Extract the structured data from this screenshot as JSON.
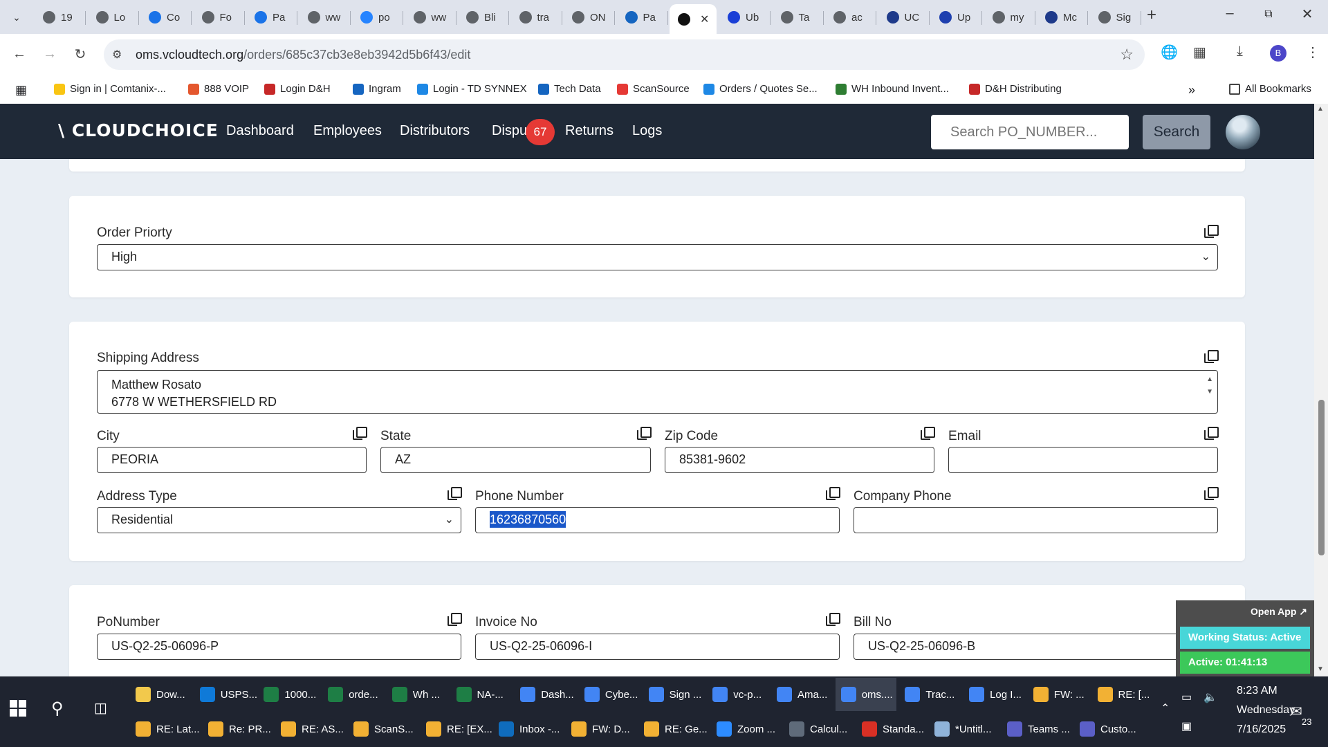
{
  "browser": {
    "tabs": [
      {
        "label": "19",
        "icon": "globe-icon",
        "color": "#5f6368"
      },
      {
        "label": "Lo",
        "icon": "globe-icon",
        "color": "#5f6368"
      },
      {
        "label": "Co",
        "icon": "logi-icon",
        "color": "#1a73e8"
      },
      {
        "label": "Fo",
        "icon": "globe-icon",
        "color": "#5f6368"
      },
      {
        "label": "Pa",
        "icon": "chevron-icon",
        "color": "#1a73e8"
      },
      {
        "label": "ww",
        "icon": "globe-icon",
        "color": "#5f6368"
      },
      {
        "label": "po",
        "icon": "jira-icon",
        "color": "#2684ff"
      },
      {
        "label": "ww",
        "icon": "globe-icon",
        "color": "#5f6368"
      },
      {
        "label": "Bli",
        "icon": "globe-icon",
        "color": "#5f6368"
      },
      {
        "label": "tra",
        "icon": "globe-icon",
        "color": "#5f6368"
      },
      {
        "label": "ON",
        "icon": "globe-icon",
        "color": "#5f6368"
      },
      {
        "label": "Pa",
        "icon": "cloud-icon",
        "color": "#1565c0"
      },
      {
        "label": "",
        "icon": "active-site-icon",
        "color": "#111111",
        "active": true
      },
      {
        "label": "Ub",
        "icon": "u-icon",
        "color": "#1a3fd6"
      },
      {
        "label": "Ta",
        "icon": "globe-icon",
        "color": "#5f6368"
      },
      {
        "label": "ac",
        "icon": "globe-icon",
        "color": "#5f6368"
      },
      {
        "label": "UC",
        "icon": "uc-icon",
        "color": "#1e3a8a"
      },
      {
        "label": "Up",
        "icon": "check-icon",
        "color": "#1e40af"
      },
      {
        "label": "my",
        "icon": "globe-icon",
        "color": "#5f6368"
      },
      {
        "label": "Mc",
        "icon": "etn-icon",
        "color": "#1e3a8a"
      },
      {
        "label": "Sig",
        "icon": "globe-icon",
        "color": "#5f6368"
      }
    ],
    "url_domain": "oms.vcloudtech.org",
    "url_path": "/orders/685c37cb3e8eb3942d5b6f43/edit",
    "profile_initial": "B",
    "bookmarks": [
      {
        "label": "Sign in | Comtanix-...",
        "color": "#f9c513"
      },
      {
        "label": "888 VOIP",
        "color": "#e4572e"
      },
      {
        "label": "Login D&H",
        "color": "#c62828"
      },
      {
        "label": "Ingram",
        "color": "#1565c0"
      },
      {
        "label": "Login - TD SYNNEX",
        "color": "#1e88e5"
      },
      {
        "label": "Tech Data",
        "color": "#1565c0"
      },
      {
        "label": "ScanSource",
        "color": "#e53935"
      },
      {
        "label": "Orders / Quotes Se...",
        "color": "#1e88e5"
      },
      {
        "label": "WH Inbound Invent...",
        "color": "#2e7d32"
      },
      {
        "label": "D&H Distributing",
        "color": "#c62828"
      }
    ],
    "all_bookmarks_label": "All Bookmarks"
  },
  "app": {
    "logo": "\\ CLOUDCHOICE",
    "nav": [
      "Dashboard",
      "Employees",
      "Distributors",
      "Dispu",
      "Returns",
      "Logs"
    ],
    "disputes_badge": "67",
    "search_placeholder": "Search PO_NUMBER...",
    "search_button": "Search"
  },
  "form": {
    "order_priority_label": "Order Priorty",
    "order_priority_value": "High",
    "shipping_address_label": "Shipping Address",
    "shipping_address_line1": "Matthew Rosato",
    "shipping_address_line2": "6778 W WETHERSFIELD RD",
    "city_label": "City",
    "city_value": "PEORIA",
    "state_label": "State",
    "state_value": "AZ",
    "zip_label": "Zip Code",
    "zip_value": "85381-9602",
    "email_label": "Email",
    "email_value": "",
    "address_type_label": "Address Type",
    "address_type_value": "Residential",
    "phone_label": "Phone Number",
    "phone_value": "16236870560",
    "company_phone_label": "Company Phone",
    "company_phone_value": "",
    "po_label": "PoNumber",
    "po_value": "US-Q2-25-06096-P",
    "invoice_label": "Invoice No",
    "invoice_value": "US-Q2-25-06096-I",
    "bill_label": "Bill No",
    "bill_value": "US-Q2-25-06096-B"
  },
  "overlay": {
    "open_app": "Open App ↗",
    "working_status": "Working Status: Active",
    "active_timer": "Active: 01:41:13"
  },
  "taskbar": {
    "row1": [
      {
        "label": "Dow...",
        "color": "#f2c94c"
      },
      {
        "label": "USPS...",
        "color": "#0f7ad8"
      },
      {
        "label": "1000...",
        "color": "#1e7e45"
      },
      {
        "label": "orde...",
        "color": "#1e7e45"
      },
      {
        "label": "Wh ...",
        "color": "#1e7e45"
      },
      {
        "label": "NA-...",
        "color": "#1e7e45"
      },
      {
        "label": "Dash...",
        "color": "#4285f4"
      },
      {
        "label": "Cybe...",
        "color": "#4285f4"
      },
      {
        "label": "Sign ...",
        "color": "#4285f4"
      },
      {
        "label": "vc-p...",
        "color": "#4285f4"
      },
      {
        "label": "Ama...",
        "color": "#4285f4"
      },
      {
        "label": "oms....",
        "color": "#4285f4",
        "active": true
      },
      {
        "label": "Trac...",
        "color": "#4285f4"
      },
      {
        "label": "Log I...",
        "color": "#4285f4"
      },
      {
        "label": "FW: ...",
        "color": "#f2b134"
      },
      {
        "label": "RE: [...",
        "color": "#f2b134"
      }
    ],
    "row2": [
      {
        "label": "RE: Lat...",
        "color": "#f2b134"
      },
      {
        "label": "Re: PR...",
        "color": "#f2b134"
      },
      {
        "label": "RE: AS...",
        "color": "#f2b134"
      },
      {
        "label": "ScanS...",
        "color": "#f2b134"
      },
      {
        "label": "RE: [EX...",
        "color": "#f2b134"
      },
      {
        "label": "Inbox -...",
        "color": "#0f6cbd"
      },
      {
        "label": "FW: D...",
        "color": "#f2b134"
      },
      {
        "label": "RE: Ge...",
        "color": "#f2b134"
      },
      {
        "label": "Zoom ...",
        "color": "#2d8cff"
      },
      {
        "label": "Calcul...",
        "color": "#5f6b7a"
      },
      {
        "label": "Standa...",
        "color": "#d93025"
      },
      {
        "label": "*Untitl...",
        "color": "#8fb3d9"
      },
      {
        "label": "Teams ...",
        "color": "#5b5fc7"
      },
      {
        "label": "Custo...",
        "color": "#5b5fc7"
      }
    ],
    "time": "8:23 AM",
    "day": "Wednesday",
    "date": "7/16/2025",
    "notifications": "23"
  }
}
